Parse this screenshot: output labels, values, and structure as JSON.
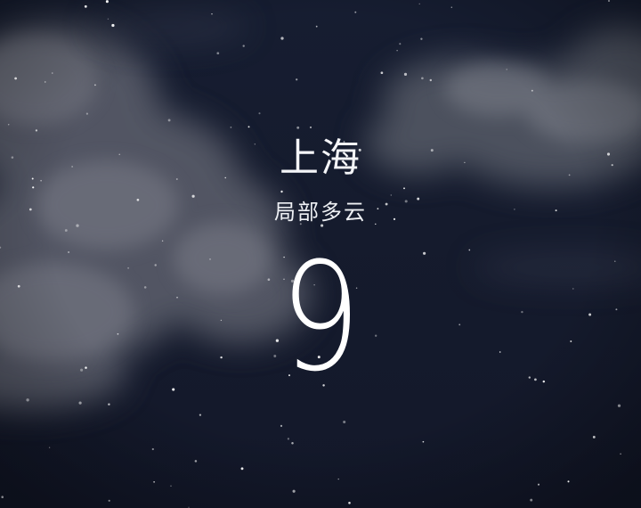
{
  "weather": {
    "city": "上海",
    "condition": "局部多云",
    "temperature": "9"
  },
  "colors": {
    "sky": "#151b2d",
    "cloud": "#6b6f7c",
    "text": "#ffffff"
  }
}
